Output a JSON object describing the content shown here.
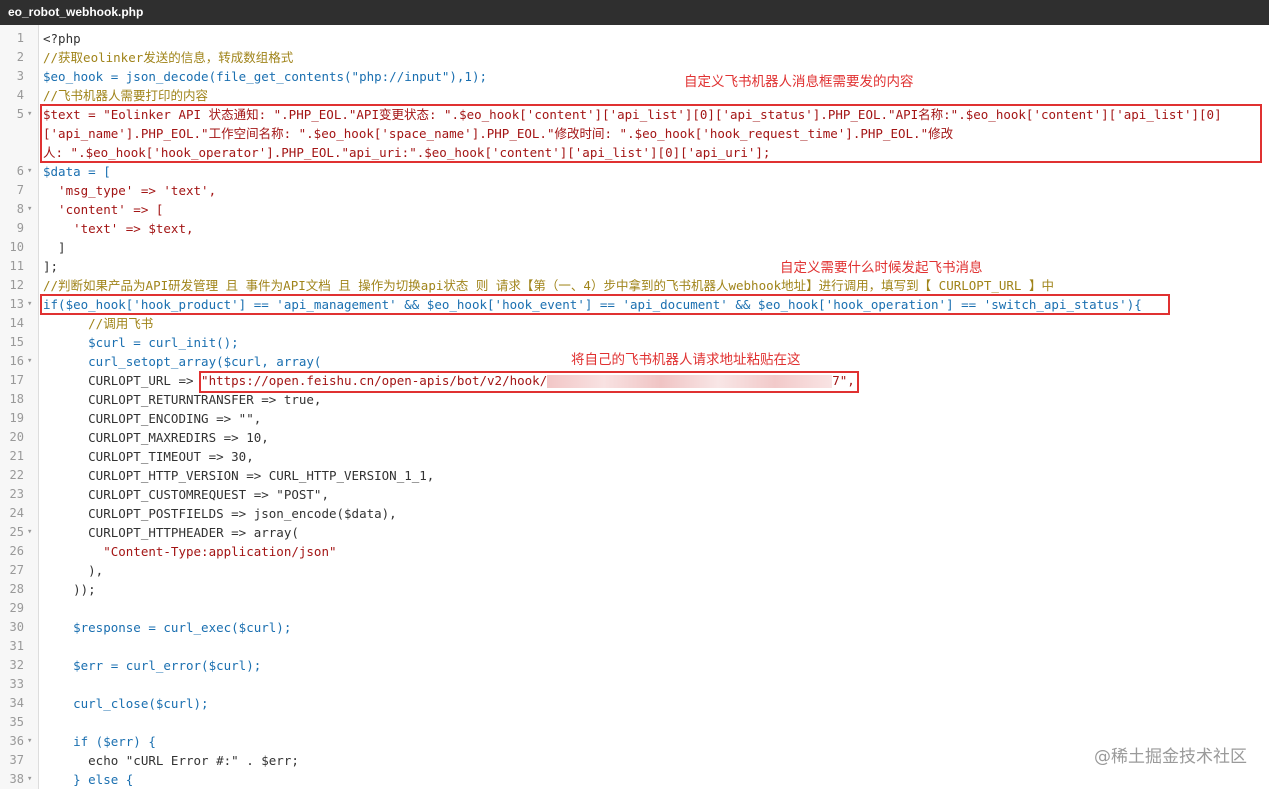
{
  "tab": {
    "filename": "eo_robot_webhook.php"
  },
  "annotations": {
    "message_content": "自定义飞书机器人消息框需要发的内容",
    "trigger_condition": "自定义需要什么时候发起飞书消息",
    "paste_url": "将自己的飞书机器人请求地址粘贴在这"
  },
  "watermark": "@稀土掘金技术社区",
  "colors": {
    "annotation_red": "#e03131",
    "comment": "#a0841a",
    "variable": "#1a6fb0",
    "string": "#a31515",
    "number": "#098658",
    "tab_bg": "#2f2f2f"
  },
  "code": {
    "l1": "<?php",
    "l2": "//获取eolinker发送的信息，转成数组格式",
    "l3": "$eo_hook = json_decode(file_get_contents(\"php://input\"),1);",
    "l4": "//飞书机器人需要打印的内容",
    "l5a": "$text = \"Eolinker API 状态通知: \".PHP_EOL.\"API变更状态: \".$eo_hook['content']['api_list'][0]['api_status'].PHP_EOL.\"API名称:\".$eo_hook['content']['api_list'][0]",
    "l5b": "['api_name'].PHP_EOL.\"工作空间名称: \".$eo_hook['space_name'].PHP_EOL.\"修改时间: \".$eo_hook['hook_request_time'].PHP_EOL.\"修改",
    "l5c": "人: \".$eo_hook['hook_operator'].PHP_EOL.\"api_uri:\".$eo_hook['content']['api_list'][0]['api_uri'];",
    "l6": "$data = [",
    "l7": "  'msg_type' => 'text',",
    "l8": "  'content' => [",
    "l9": "    'text' => $text,",
    "l10": "  ]",
    "l11": "];",
    "l12": "//判断如果产品为API研发管理 且 事件为API文档 且 操作为切换api状态 则 请求【第（一、4）步中拿到的飞书机器人webhook地址】进行调用，填写到【 CURLOPT_URL 】中",
    "l13": "if($eo_hook['hook_product'] == 'api_management' && $eo_hook['hook_event'] == 'api_document' && $eo_hook['hook_operation'] == 'switch_api_status'){",
    "l14": "      //调用飞书",
    "l15": "      $curl = curl_init();",
    "l16": "      curl_setopt_array($curl, array(",
    "l17a": "      CURLOPT_URL => ",
    "l17b": "\"https://open.feishu.cn/open-apis/bot/v2/hook/",
    "l17c": "7\",",
    "l18": "      CURLOPT_RETURNTRANSFER => true,",
    "l19": "      CURLOPT_ENCODING => \"\",",
    "l20": "      CURLOPT_MAXREDIRS => 10,",
    "l21": "      CURLOPT_TIMEOUT => 30,",
    "l22": "      CURLOPT_HTTP_VERSION => CURL_HTTP_VERSION_1_1,",
    "l23": "      CURLOPT_CUSTOMREQUEST => \"POST\",",
    "l24": "      CURLOPT_POSTFIELDS => json_encode($data),",
    "l25": "      CURLOPT_HTTPHEADER => array(",
    "l26": "        \"Content-Type:application/json\"",
    "l27": "      ),",
    "l28": "    ));",
    "l29": "",
    "l30": "    $response = curl_exec($curl);",
    "l31": "",
    "l32": "    $err = curl_error($curl);",
    "l33": "",
    "l34": "    curl_close($curl);",
    "l35": "",
    "l36": "    if ($err) {",
    "l37": "      echo \"cURL Error #:\" . $err;",
    "l38": "    } else {"
  },
  "line_numbers": [
    "1",
    "2",
    "3",
    "4",
    "5",
    "",
    "",
    "6",
    "7",
    "8",
    "9",
    "10",
    "11",
    "12",
    "13",
    "14",
    "15",
    "16",
    "17",
    "18",
    "19",
    "20",
    "21",
    "22",
    "23",
    "24",
    "25",
    "26",
    "27",
    "28",
    "29",
    "30",
    "31",
    "32",
    "33",
    "34",
    "35",
    "36",
    "37",
    "38"
  ],
  "fold_marker": "▾"
}
